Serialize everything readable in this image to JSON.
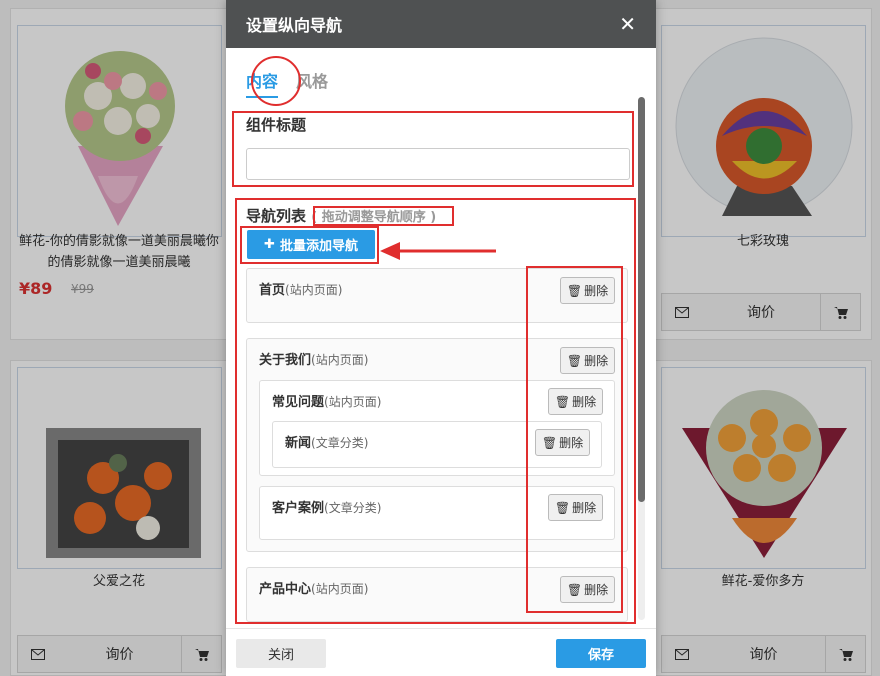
{
  "products": [
    {
      "name": "鲜花-你的倩影就像一道美丽晨曦你的倩影就像一道美丽晨曦",
      "price": "¥89",
      "old_price": "¥99"
    },
    {
      "name": "七彩玫瑰",
      "action": "询价"
    },
    {
      "name": "父爱之花",
      "action": "询价"
    },
    {
      "name": "鲜花-爱你多方",
      "action": "询价"
    }
  ],
  "modal": {
    "title": "设置纵向导航",
    "tabs": [
      "内容",
      "风格"
    ],
    "component_title_label": "组件标题",
    "component_title_value": "",
    "nav_list_label": "导航列表",
    "nav_list_hint": "( 拖动调整导航顺序 )",
    "batch_add_label": "批量添加导航",
    "delete_label": "删除",
    "nav_items": [
      {
        "label": "首页",
        "type": "(站内页面)"
      },
      {
        "label": "关于我们",
        "type": "(站内页面)"
      },
      {
        "label": "常见问题",
        "type": "(站内页面)"
      },
      {
        "label": "新闻",
        "type": "(文章分类)"
      },
      {
        "label": "客户案例",
        "type": "(文章分类)"
      },
      {
        "label": "产品中心",
        "type": "(站内页面)"
      }
    ],
    "close_label": "关闭",
    "save_label": "保存"
  },
  "colors": {
    "accent": "#2a9be4",
    "header_bg": "#4f5152",
    "annotation_red": "#e02e2e",
    "price_red": "#d33333"
  },
  "icons": [
    "close-icon",
    "plus-icon",
    "trash-icon",
    "mail-icon",
    "cart-icon"
  ]
}
